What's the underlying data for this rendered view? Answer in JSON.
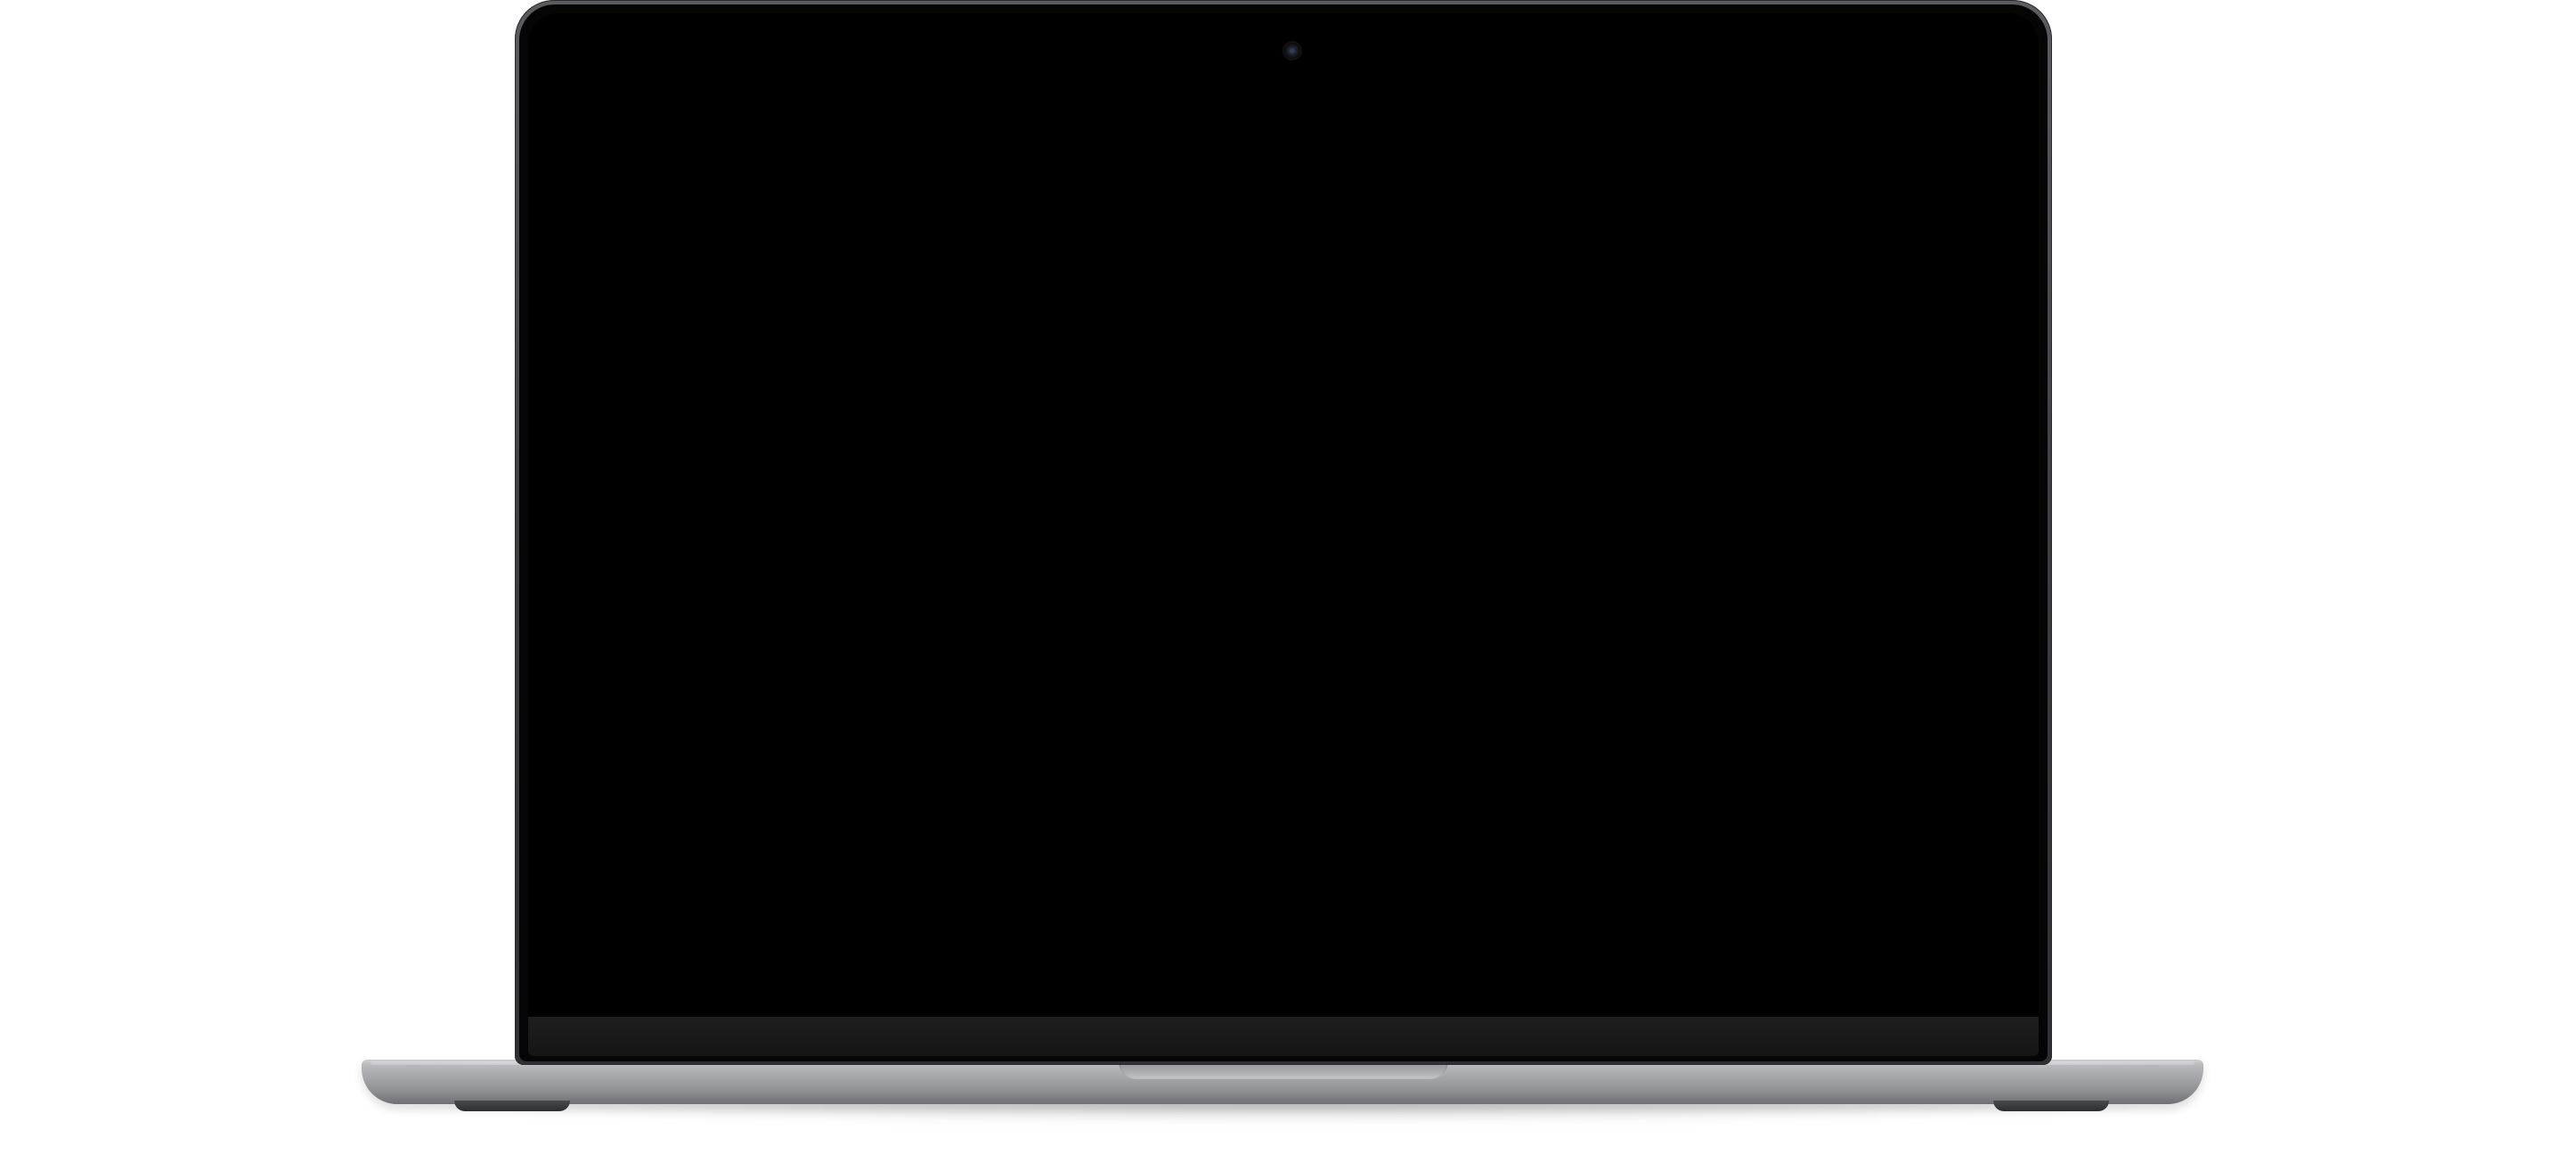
{
  "scene": {
    "device": "laptop",
    "screen_state": "off",
    "colors": {
      "background": "#ffffff",
      "screen": "#000000",
      "bezel": "#050505",
      "lid_frame": "#3d3e41",
      "base": "#a9aaad"
    },
    "icons": {
      "camera": "camera-icon"
    }
  }
}
